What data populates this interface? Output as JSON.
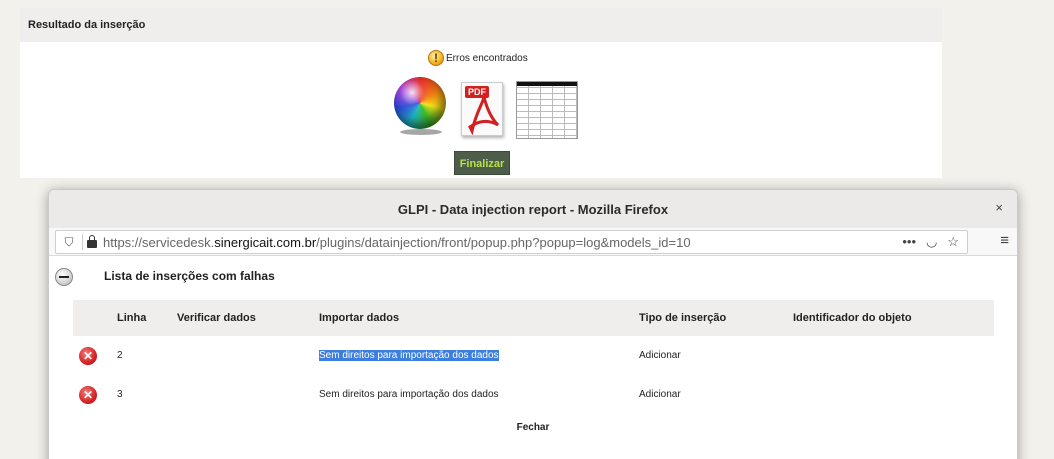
{
  "background": {
    "header_title": "Resultado da inserção",
    "errors_text": "Erros encontrados",
    "finalize_label": "Finalizar",
    "icons": [
      "warning-icon",
      "color-ball-icon",
      "pdf-icon",
      "spreadsheet-icon"
    ]
  },
  "window": {
    "title": "GLPI - Data injection report - Mozilla Firefox",
    "close_glyph": "×",
    "url_prefix": "https://servicedesk.",
    "url_host": "sinergicait.com.br",
    "url_path": "/plugins/datainjection/front/popup.php?popup=log&models_id=10"
  },
  "report": {
    "list_title": "Lista de inserções com falhas",
    "columns": [
      "Linha",
      "Verificar dados",
      "Importar dados",
      "Tipo de inserção",
      "Identificador do objeto"
    ],
    "rows": [
      {
        "line": "2",
        "verify": "",
        "import": "Sem direitos para importação dos dados",
        "type": "Adicionar",
        "identifier": "",
        "selected": true
      },
      {
        "line": "3",
        "verify": "",
        "import": "Sem direitos para importação dos dados",
        "type": "Adicionar",
        "identifier": "",
        "selected": false
      }
    ],
    "close_label": "Fechar"
  },
  "colors": {
    "accent_selection": "#3c7fe0",
    "finalize_bg": "#4d5d4a",
    "finalize_text": "#b6e04a",
    "error_red": "#d42424"
  }
}
